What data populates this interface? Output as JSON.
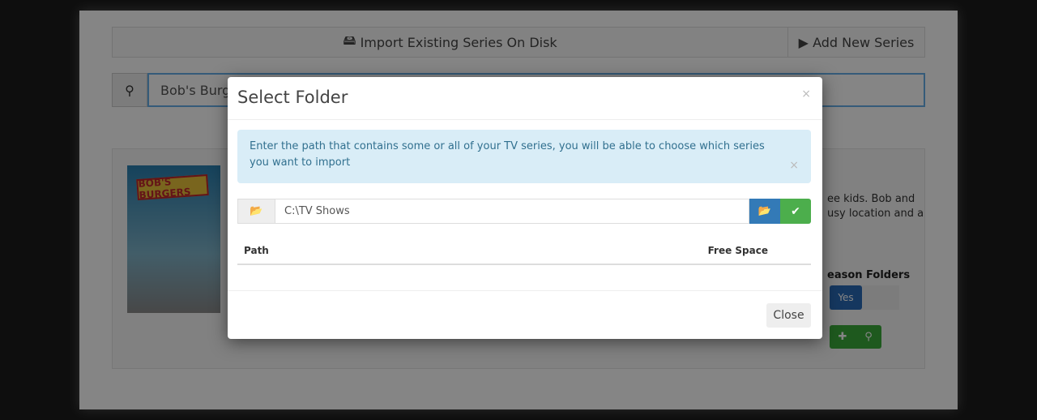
{
  "tabs": {
    "import_label": "Import Existing Series On Disk",
    "import_icon": "hdd-icon",
    "add_label": "Add New Series",
    "add_icon": "play-icon"
  },
  "search": {
    "value": "Bob's Burgers",
    "icon": "search-icon"
  },
  "series": {
    "logo_text": "BOB'S BURGERS",
    "description_line1": "ee kids. Bob and",
    "description_line2": "usy location and a",
    "season_folders_label": "eason Folders",
    "season_folders_value": "Yes"
  },
  "modal": {
    "title": "Select Folder",
    "close_symbol": "×",
    "alert_text": "Enter the path that contains some or all of your TV series, you will be able to choose which series you want to import",
    "path_value": "C:\\TV Shows",
    "columns": [
      "Path",
      "Free Space"
    ],
    "close_button": "Close"
  },
  "colors": {
    "primary": "#337ab7",
    "success": "#4cae4c",
    "info_bg": "#d9edf7",
    "info_text": "#31708f"
  }
}
